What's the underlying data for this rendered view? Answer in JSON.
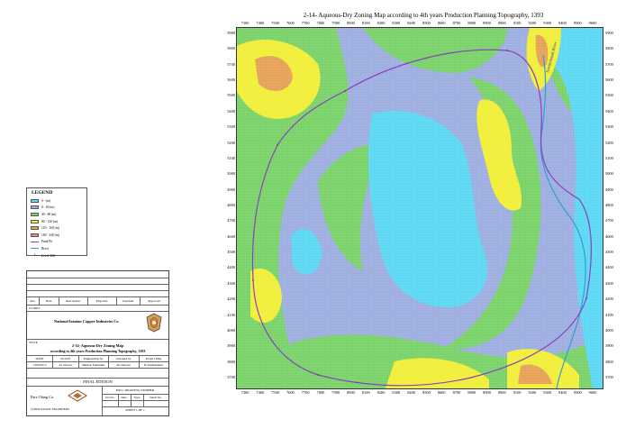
{
  "map": {
    "title": "2-14- Aqueous-Dry Zoning Map according to 4th years Production Planning Topography, 1393",
    "river_label": "Sarcheshmeh River",
    "x_ticks": [
      "7300",
      "7400",
      "7500",
      "7600",
      "7700",
      "7800",
      "7900",
      "8000",
      "8100",
      "8200",
      "8300",
      "8400",
      "8500",
      "8600",
      "8700",
      "8800",
      "8900",
      "9000",
      "9100",
      "9200",
      "9300",
      "9400",
      "9500",
      "9600"
    ],
    "y_ticks": [
      "5900",
      "5800",
      "5700",
      "5600",
      "5500",
      "5400",
      "5300",
      "5200",
      "5100",
      "5000",
      "4900",
      "4800",
      "4700",
      "4600",
      "4500",
      "4400",
      "4300",
      "4200",
      "4100",
      "4000",
      "3900",
      "3800",
      "3700"
    ],
    "colors": {
      "zone_0_20": "#5fd8f4",
      "zone_20_40": "#9fb0e0",
      "zone_40_80": "#7dd36b",
      "zone_80_120": "#f1ee3c",
      "zone_120_160": "#e7a35a",
      "zone_160_240": "#e88a8a",
      "final_pit": "#8a3fbf",
      "river": "#2f9fd6"
    }
  },
  "legend": {
    "title": "LEGEND",
    "items": [
      {
        "label": "0 - (m)",
        "kind": "fill",
        "color": "#5fd8f4"
      },
      {
        "label": "0 - 40 (m)",
        "kind": "fill",
        "color": "#9fb0e0"
      },
      {
        "label": "40 - 80 (m)",
        "kind": "fill",
        "color": "#7dd36b"
      },
      {
        "label": "80 - 120 (m)",
        "kind": "fill",
        "color": "#f1ee3c"
      },
      {
        "label": "120 - 160 (m)",
        "kind": "fill",
        "color": "#e7a35a"
      },
      {
        "label": "160 - 240 (m)",
        "kind": "fill",
        "color": "#e88a8a"
      },
      {
        "label": "Final Pit",
        "kind": "line",
        "color": "#8a3fbf"
      },
      {
        "label": "River",
        "kind": "line",
        "color": "#2f9fd6"
      },
      {
        "label": "Level 3SZ",
        "kind": "dot",
        "color": "#555555"
      }
    ]
  },
  "title_block": {
    "header": [
      "Rev.",
      "Date",
      "Description",
      "Prepared",
      "Checked",
      "Approved"
    ],
    "client_label": "CLINET",
    "client_name": "National Iranian Copper Industries Co",
    "title_label": "TITLE",
    "title_line1": "2-14- Aqueous-Dry Zoning Map",
    "title_line2": "according to 4th years Production Planning Topography, 1393",
    "info_header": [
      "DATE",
      "SCALE",
      "Engineering by",
      "Checked by",
      "Project Mng"
    ],
    "info_values": [
      "1393/2013",
      "As Shown",
      "Shumas Fakhrami",
      "Sh.Sabrani",
      "R.Yazdkhokim"
    ],
    "edition": "FINAL EDITION",
    "company": "Pars Olang Co.",
    "consultant": "CONSULTANT ENGINEERS",
    "drawing_label": "POLC DRAWING NUMBER",
    "drawing_fields": [
      "Job No.",
      "Disc.",
      "Type",
      "Serial No."
    ],
    "sheet": "SHEET 1 OF 1"
  }
}
